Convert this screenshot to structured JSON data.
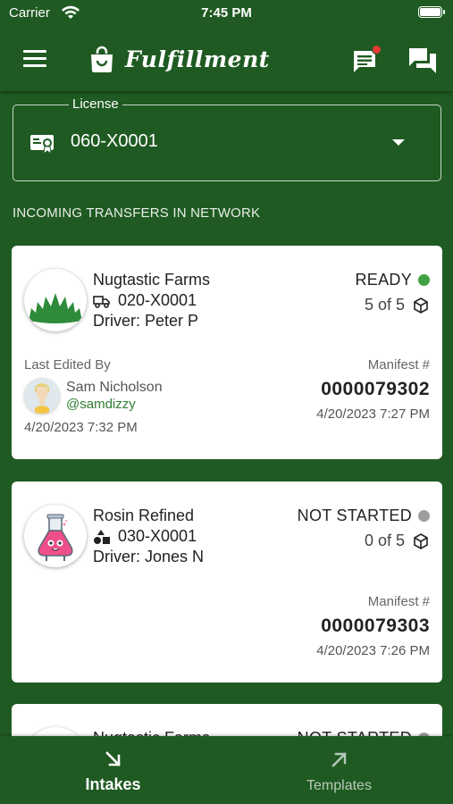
{
  "status_bar": {
    "carrier": "Carrier",
    "time": "7:45 PM"
  },
  "app_bar": {
    "title": "Fulfillment",
    "icons": [
      "menu-icon",
      "shopping-bag-icon",
      "notifications-icon",
      "chat-icon"
    ]
  },
  "license_selector": {
    "label": "License",
    "value": "060-X0001",
    "icon": "license-badge-icon"
  },
  "section_header": "INCOMING TRANSFERS IN NETWORK",
  "transfers": [
    {
      "vendor": "Nugtastic Farms",
      "license": "020-X0001",
      "driver": "Driver: Peter P",
      "status": "READY",
      "status_color": "#43a047",
      "count": "5 of 5",
      "last_edited_label": "Last Edited By",
      "editor_name": "Sam Nicholson",
      "editor_handle": "@samdizzy",
      "edited_date": "4/20/2023 7:32 PM",
      "manifest_label": "Manifest #",
      "manifest_number": "0000079302",
      "manifest_date": "4/20/2023 7:27 PM"
    },
    {
      "vendor": "Rosin Refined",
      "license": "030-X0001",
      "driver": "Driver: Jones N",
      "status": "NOT STARTED",
      "status_color": "#9e9e9e",
      "count": "0 of 5",
      "manifest_label": "Manifest #",
      "manifest_number": "0000079303",
      "manifest_date": "4/20/2023 7:26 PM"
    },
    {
      "vendor": "Nugtastic Farms",
      "status": "NOT STARTED",
      "status_color": "#9e9e9e"
    }
  ],
  "tabs": [
    {
      "label": "Intakes",
      "icon": "arrow-down-right-icon",
      "active": true
    },
    {
      "label": "Templates",
      "icon": "arrow-up-right-icon",
      "active": false
    }
  ]
}
